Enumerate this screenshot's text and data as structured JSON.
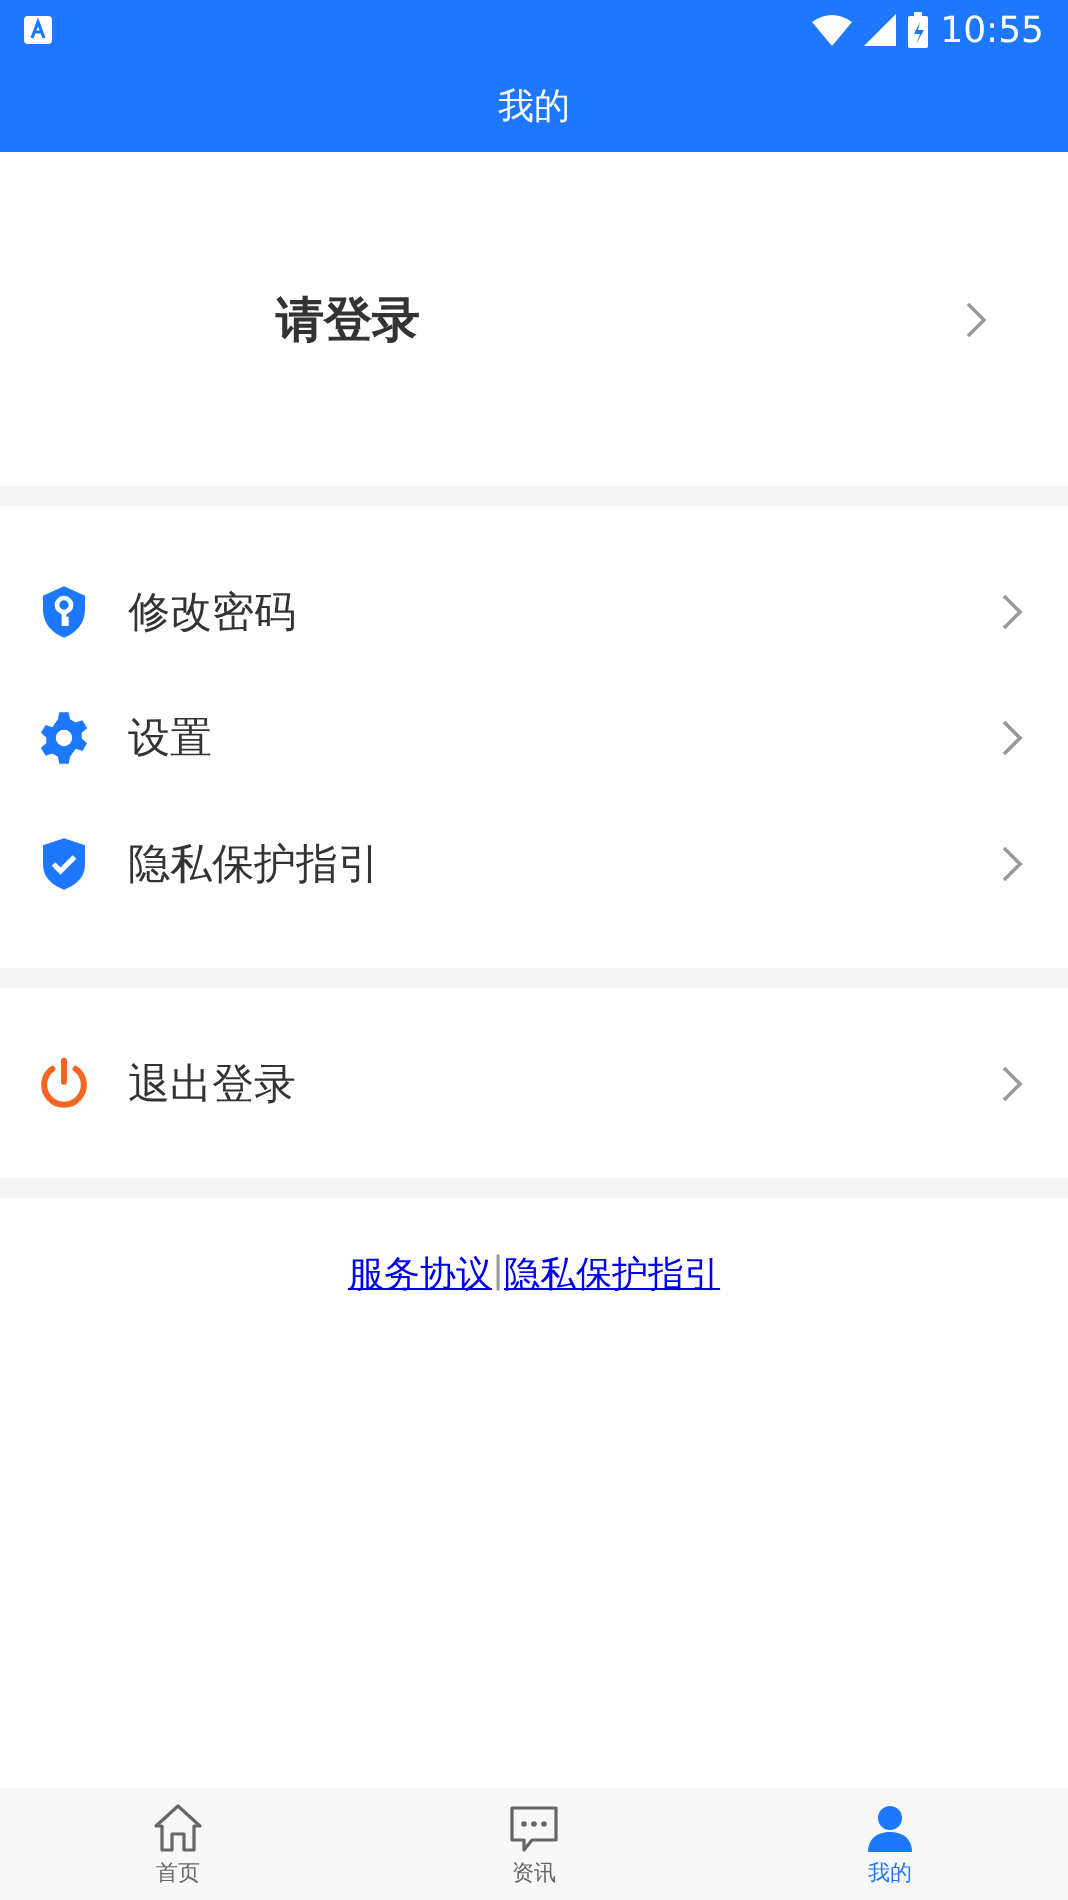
{
  "status_bar": {
    "time": "10:55"
  },
  "header": {
    "title": "我的"
  },
  "login": {
    "label": "请登录"
  },
  "menu": [
    {
      "label": "修改密码",
      "kind": "key"
    },
    {
      "label": "设置",
      "kind": "gear"
    },
    {
      "label": "隐私保护指引",
      "kind": "shield"
    }
  ],
  "logout": {
    "label": "退出登录",
    "kind": "power"
  },
  "links": {
    "items": [
      "服务协议",
      "隐私保护指引"
    ],
    "separator": "|"
  },
  "tabs": [
    {
      "label": "首页",
      "kind": "home",
      "selected": false
    },
    {
      "label": "资讯",
      "kind": "chat",
      "selected": false
    },
    {
      "label": "我的",
      "kind": "person",
      "selected": true
    }
  ]
}
